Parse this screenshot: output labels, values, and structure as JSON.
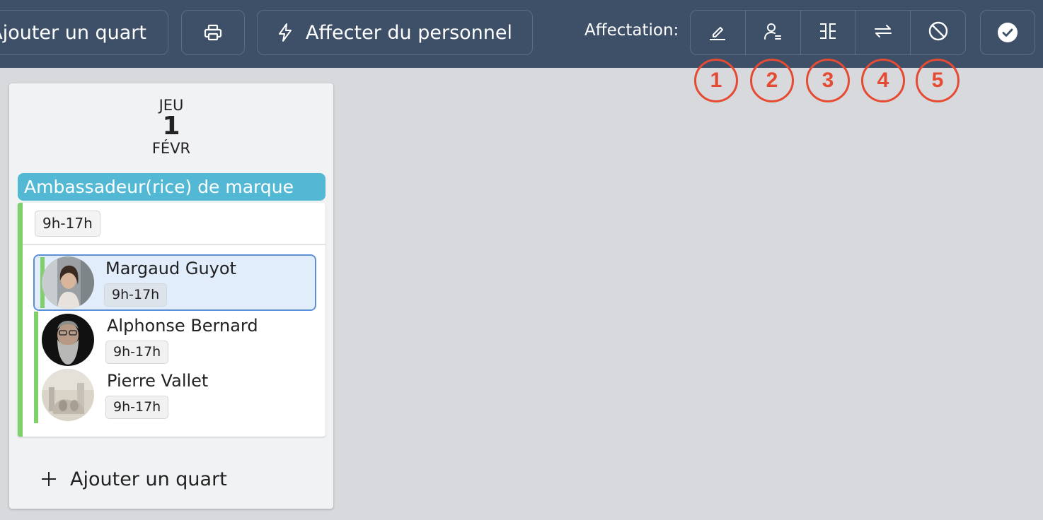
{
  "toolbar": {
    "add_shift_label": "Ajouter un quart",
    "print_icon": "printer-icon",
    "assign_staff_label": "Affecter du personnel",
    "assign_staff_icon": "lightning-icon",
    "assignment_label": "Affectation:",
    "assignment_tools": [
      {
        "icon": "pencil-icon",
        "marker": "1"
      },
      {
        "icon": "user-assign-icon",
        "marker": "2"
      },
      {
        "icon": "split-columns-icon",
        "marker": "3"
      },
      {
        "icon": "swap-arrows-icon",
        "marker": "4"
      },
      {
        "icon": "block-icon",
        "marker": "5"
      }
    ],
    "confirm_icon": "check-circle-icon"
  },
  "day": {
    "weekday": "JEU",
    "day_number": "1",
    "month": "FÉVR",
    "role": "Ambassadeur(rice) de marque",
    "shift_time": "9h-17h",
    "employees": [
      {
        "name": "Margaud Guyot",
        "time": "9h-17h",
        "selected": true
      },
      {
        "name": "Alphonse Bernard",
        "time": "9h-17h",
        "selected": false
      },
      {
        "name": "Pierre Vallet",
        "time": "9h-17h",
        "selected": false
      }
    ],
    "add_shift_label": "Ajouter un quart"
  },
  "colors": {
    "toolbar_bg": "#3d5068",
    "role_bar": "#52b8d4",
    "shift_accent": "#7fd06a",
    "marker_red": "#e54b33",
    "selected_bg": "#e2edfb",
    "selected_border": "#5d8fd8"
  }
}
